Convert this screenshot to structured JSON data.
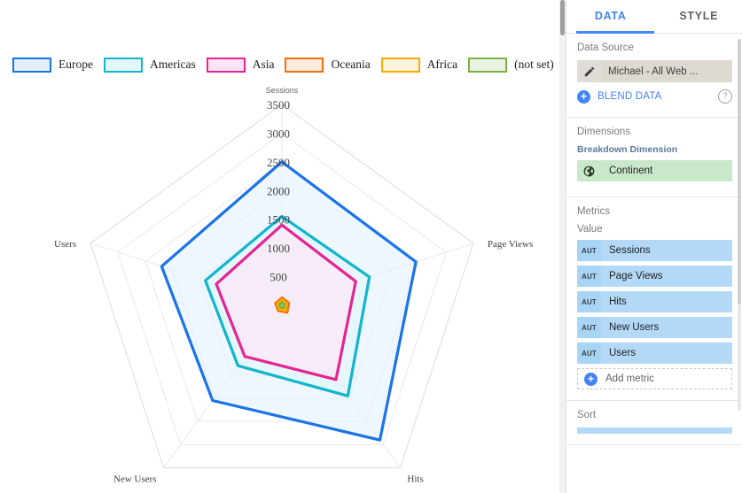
{
  "legend": {
    "items": [
      {
        "label": "Europe",
        "stroke": "#1a73e8",
        "fill": "#e3f0fd"
      },
      {
        "label": "Americas",
        "stroke": "#12b5cb",
        "fill": "#e1f7fa"
      },
      {
        "label": "Asia",
        "stroke": "#e52592",
        "fill": "#fde5f3"
      },
      {
        "label": "Oceania",
        "stroke": "#f2700d",
        "fill": "#fdeade"
      },
      {
        "label": "Africa",
        "stroke": "#faab00",
        "fill": "#fef3dc"
      },
      {
        "label": "(not set)",
        "stroke": "#7cb342",
        "fill": "#eaf3e3"
      }
    ]
  },
  "chart_data": {
    "type": "radar",
    "title": "",
    "axes": [
      "Sessions",
      "Page Views",
      "Hits",
      "New Users",
      "Users"
    ],
    "tick_labels": [
      "500",
      "1000",
      "1500",
      "2000",
      "2500",
      "3000",
      "3500"
    ],
    "ticks": [
      500,
      1000,
      1500,
      2000,
      2500,
      3000,
      3500
    ],
    "rmax": 3500,
    "grid": true,
    "legend_position": "top",
    "series": [
      {
        "name": "Europe",
        "values": [
          2500,
          2450,
          2900,
          2050,
          2200
        ]
      },
      {
        "name": "Americas",
        "values": [
          1550,
          1600,
          1950,
          1300,
          1400
        ]
      },
      {
        "name": "Asia",
        "values": [
          1400,
          1350,
          1600,
          1100,
          1200
        ]
      },
      {
        "name": "Oceania",
        "values": [
          130,
          125,
          150,
          110,
          115
        ]
      },
      {
        "name": "Africa",
        "values": [
          95,
          90,
          105,
          80,
          85
        ]
      },
      {
        "name": "(not set)",
        "values": [
          45,
          42,
          50,
          38,
          40
        ]
      }
    ]
  },
  "panel": {
    "tabs": [
      {
        "label": "DATA",
        "active": true
      },
      {
        "label": "STYLE",
        "active": false
      }
    ],
    "data_source": {
      "section_title": "Data Source",
      "edit_icon": "pencil-icon",
      "name": "Michael - All Web ...",
      "blend_label": "BLEND DATA",
      "blend_icon": "plus-circle-icon",
      "help_icon": "help-icon",
      "help_glyph": "?"
    },
    "dimensions": {
      "section_title": "Dimensions",
      "sub_title": "Breakdown Dimension",
      "chips": [
        {
          "icon": "globe-icon",
          "label": "Continent"
        }
      ]
    },
    "metrics": {
      "section_title": "Metrics",
      "field_label": "Value",
      "chips": [
        {
          "badge": "AUT",
          "label": "Sessions"
        },
        {
          "badge": "AUT",
          "label": "Page Views"
        },
        {
          "badge": "AUT",
          "label": "Hits"
        },
        {
          "badge": "AUT",
          "label": "New Users"
        },
        {
          "badge": "AUT",
          "label": "Users"
        }
      ],
      "add_label": "Add metric",
      "add_icon": "plus-circle-icon"
    },
    "sort": {
      "section_title": "Sort"
    }
  },
  "colors": {
    "accent": "#4285f4",
    "dimension_chip": "#c9e7c9",
    "metric_chip": "#b3d9f7",
    "source_chip": "#ddd9d0"
  }
}
